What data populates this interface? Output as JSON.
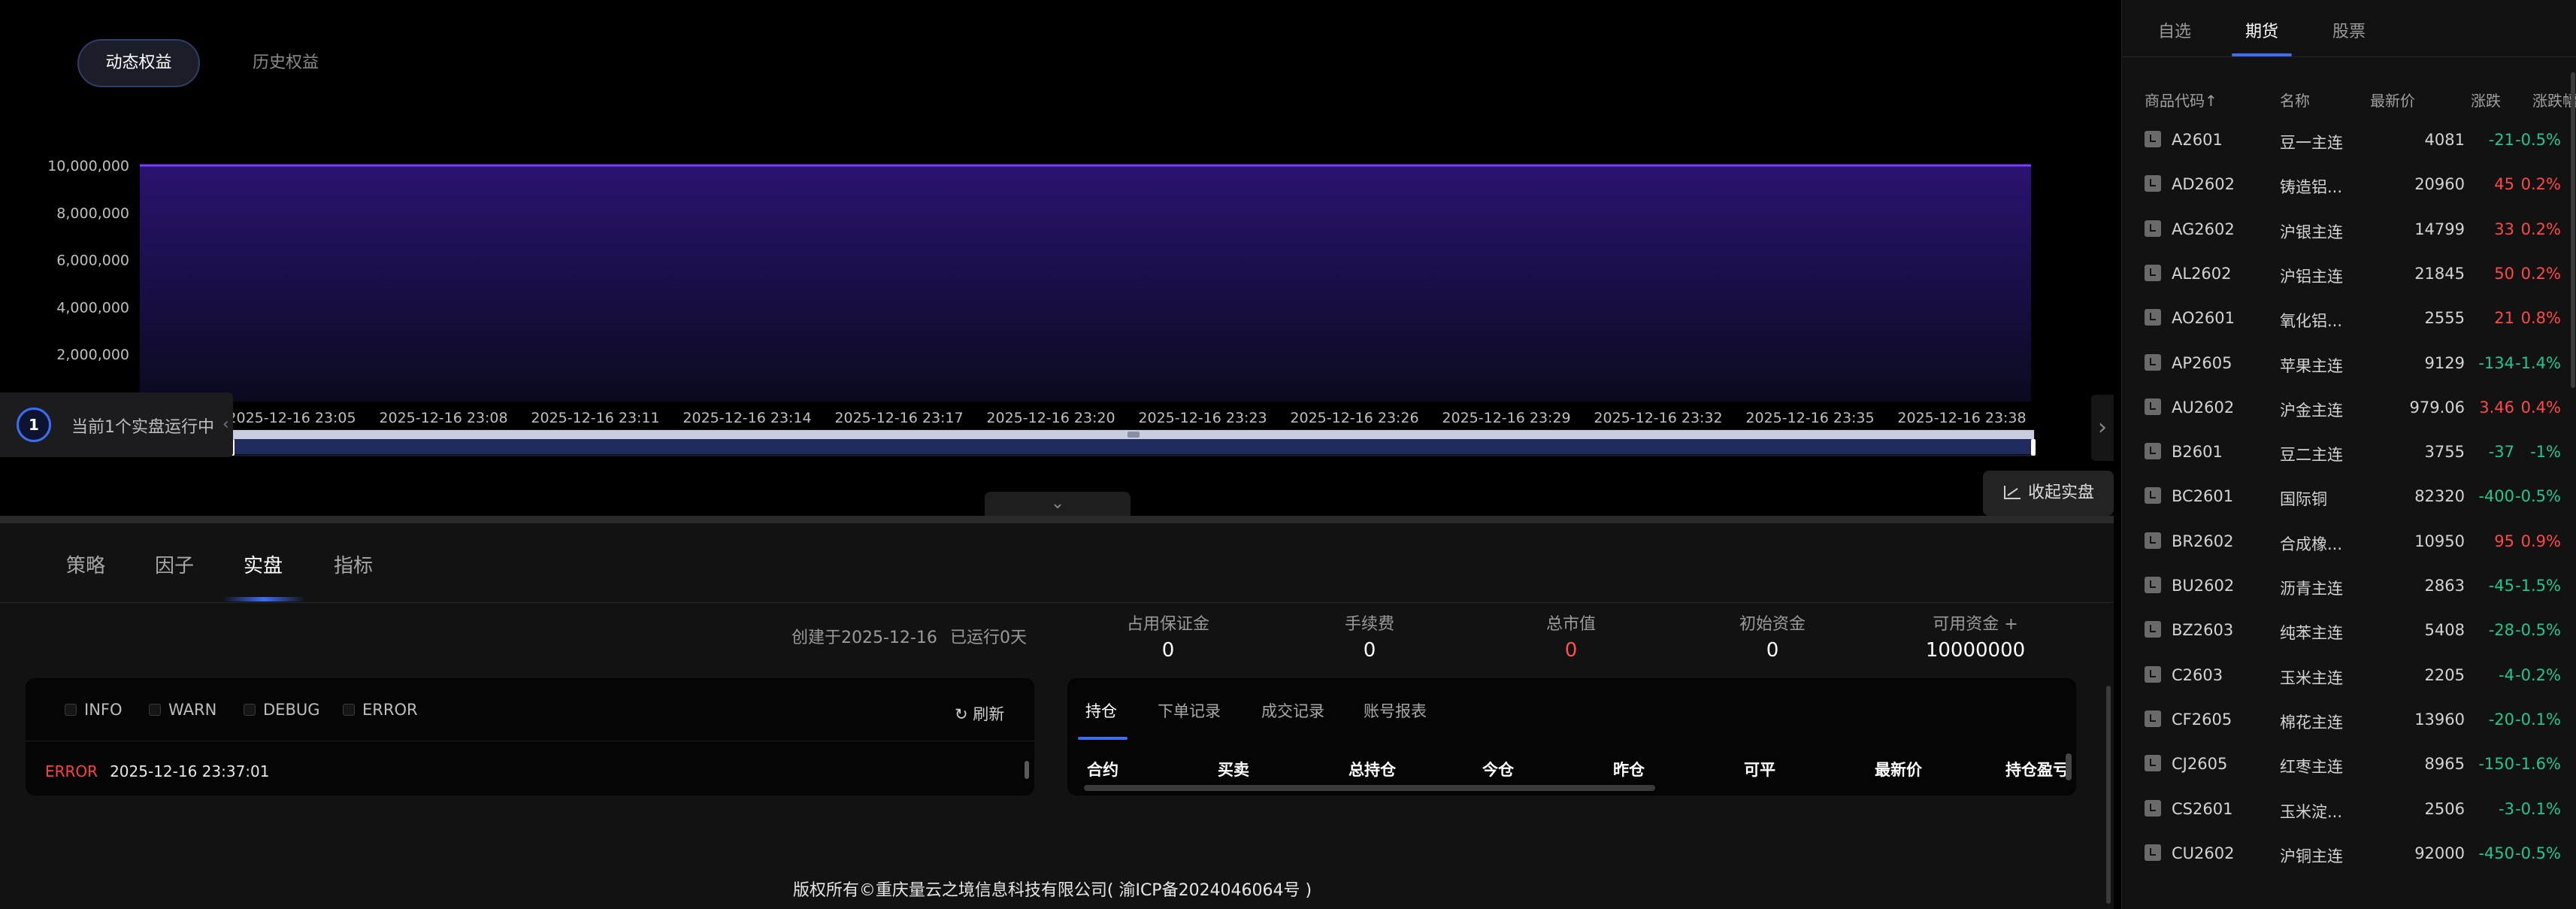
{
  "equity_tabs": {
    "dynamic": "动态权益",
    "history": "历史权益"
  },
  "chart_data": {
    "type": "area",
    "title": "",
    "xlabel": "",
    "ylabel": "",
    "y_ticks": [
      "2,000,000",
      "4,000,000",
      "6,000,000",
      "8,000,000",
      "10,000,000"
    ],
    "ylim": [
      0,
      10000000
    ],
    "x_ticks": [
      "2025-12-16 23:05",
      "2025-12-16 23:08",
      "2025-12-16 23:11",
      "2025-12-16 23:14",
      "2025-12-16 23:17",
      "2025-12-16 23:20",
      "2025-12-16 23:23",
      "2025-12-16 23:26",
      "2025-12-16 23:29",
      "2025-12-16 23:32",
      "2025-12-16 23:35",
      "2025-12-16 23:38"
    ],
    "series": [
      {
        "values": [
          10000000,
          10000000,
          10000000,
          10000000,
          10000000,
          10000000,
          10000000,
          10000000,
          10000000,
          10000000,
          10000000,
          10000000
        ]
      }
    ],
    "grid": true,
    "line_color": "#7c3cff",
    "slider_selection": [
      0,
      1
    ]
  },
  "running_badge": {
    "count": "1",
    "text": "当前1个实盘运行中",
    "arrow": "‹"
  },
  "right_expander": {
    "arrow": "›"
  },
  "collapse_toggle": {
    "chevron": "⌄"
  },
  "collapse_live": {
    "label": "收起实盘"
  },
  "main_tabs": [
    "策略",
    "因子",
    "实盘",
    "指标"
  ],
  "main_tab_active": 2,
  "meta": {
    "created": "创建于2025-12-16",
    "running": "已运行0天"
  },
  "stats": [
    {
      "label": "占用保证金",
      "value": "0",
      "red": false
    },
    {
      "label": "手续费",
      "value": "0",
      "red": false
    },
    {
      "label": "总市值",
      "value": "0",
      "red": true
    },
    {
      "label": "初始资金",
      "value": "0",
      "red": false
    },
    {
      "label": "可用资金 +",
      "value": "10000000",
      "red": false
    }
  ],
  "log": {
    "filters": [
      "INFO",
      "WARN",
      "DEBUG",
      "ERROR"
    ],
    "refresh": "↻ 刷新",
    "entries": [
      {
        "level": "ERROR",
        "time": "2025-12-16 23:37:01"
      }
    ]
  },
  "positions": {
    "tabs": [
      "持仓",
      "下单记录",
      "成交记录",
      "账号报表"
    ],
    "headers": [
      "合约",
      "买卖",
      "总持仓",
      "今仓",
      "昨仓",
      "可平",
      "最新价",
      "持仓盈亏"
    ]
  },
  "footer": {
    "copyright": "版权所有©重庆量云之境信息科技有限公司( 渝ICP备2024046064号 )"
  },
  "sidebar": {
    "tabs": [
      "自选",
      "期货",
      "股票"
    ],
    "active_tab": 1,
    "headers": {
      "code": "商品代码↑",
      "name": "名称",
      "price": "最新价",
      "change": "涨跌",
      "pct": "涨跌幅"
    },
    "rows": [
      {
        "code": "A2601",
        "name": "豆一主连",
        "price": "4081",
        "change": "-21",
        "pct": "-0.5%",
        "dir": "down"
      },
      {
        "code": "AD2602",
        "name": "铸造铝...",
        "price": "20960",
        "change": "45",
        "pct": "0.2%",
        "dir": "up"
      },
      {
        "code": "AG2602",
        "name": "沪银主连",
        "price": "14799",
        "change": "33",
        "pct": "0.2%",
        "dir": "up"
      },
      {
        "code": "AL2602",
        "name": "沪铝主连",
        "price": "21845",
        "change": "50",
        "pct": "0.2%",
        "dir": "up"
      },
      {
        "code": "AO2601",
        "name": "氧化铝...",
        "price": "2555",
        "change": "21",
        "pct": "0.8%",
        "dir": "up"
      },
      {
        "code": "AP2605",
        "name": "苹果主连",
        "price": "9129",
        "change": "-134",
        "pct": "-1.4%",
        "dir": "down"
      },
      {
        "code": "AU2602",
        "name": "沪金主连",
        "price": "979.06",
        "change": "3.46",
        "pct": "0.4%",
        "dir": "up"
      },
      {
        "code": "B2601",
        "name": "豆二主连",
        "price": "3755",
        "change": "-37",
        "pct": "-1%",
        "dir": "down"
      },
      {
        "code": "BC2601",
        "name": "国际铜",
        "price": "82320",
        "change": "-400",
        "pct": "-0.5%",
        "dir": "down"
      },
      {
        "code": "BR2602",
        "name": "合成橡...",
        "price": "10950",
        "change": "95",
        "pct": "0.9%",
        "dir": "up"
      },
      {
        "code": "BU2602",
        "name": "沥青主连",
        "price": "2863",
        "change": "-45",
        "pct": "-1.5%",
        "dir": "down"
      },
      {
        "code": "BZ2603",
        "name": "纯苯主连",
        "price": "5408",
        "change": "-28",
        "pct": "-0.5%",
        "dir": "down"
      },
      {
        "code": "C2603",
        "name": "玉米主连",
        "price": "2205",
        "change": "-4",
        "pct": "-0.2%",
        "dir": "down"
      },
      {
        "code": "CF2605",
        "name": "棉花主连",
        "price": "13960",
        "change": "-20",
        "pct": "-0.1%",
        "dir": "down"
      },
      {
        "code": "CJ2605",
        "name": "红枣主连",
        "price": "8965",
        "change": "-150",
        "pct": "-1.6%",
        "dir": "down"
      },
      {
        "code": "CS2601",
        "name": "玉米淀...",
        "price": "2506",
        "change": "-3",
        "pct": "-0.1%",
        "dir": "down"
      },
      {
        "code": "CU2602",
        "name": "沪铜主连",
        "price": "92000",
        "change": "-450",
        "pct": "-0.5%",
        "dir": "down"
      }
    ]
  }
}
